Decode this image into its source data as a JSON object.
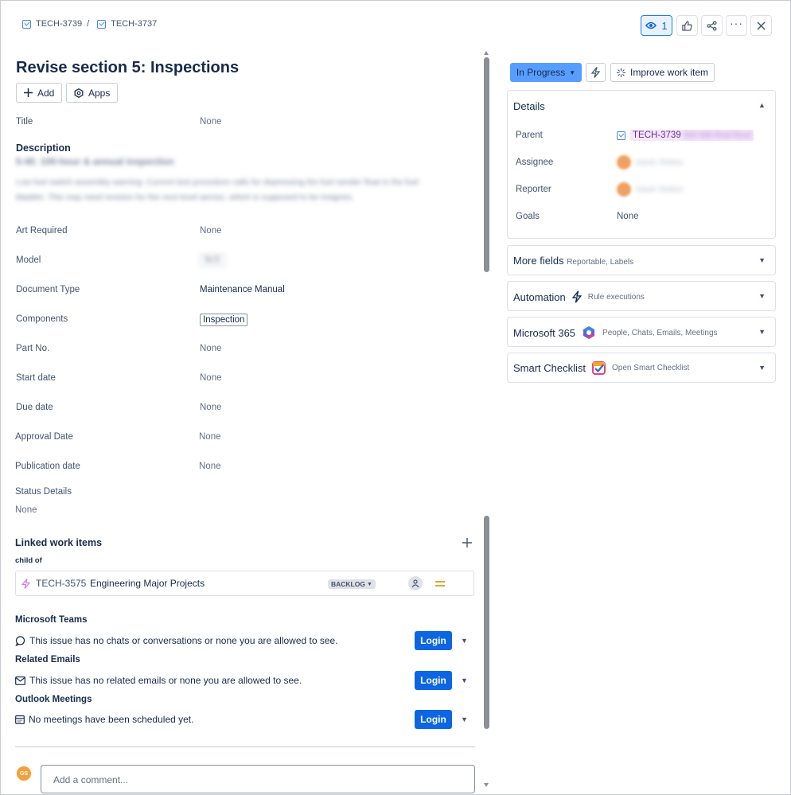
{
  "breadcrumb": {
    "parent_key": "TECH-3739",
    "separator": "/",
    "current_key": "TECH-3737"
  },
  "toolbar": {
    "watch_count": "1"
  },
  "issue": {
    "title": "Revise section 5: Inspections",
    "add_label": "Add",
    "apps_label": "Apps"
  },
  "fields": {
    "title_label": "Title",
    "title_value": "None",
    "description_label": "Description",
    "description_heading": "5-40. 100-hour & annual inspection",
    "description_body_1": "Low fuel switch assembly warning: Current test procedure calls for depressing the fuel sender float in the fuel",
    "description_body_2": "bladder. This may need revision for the next level aerosc. which is supposed to be insignes.",
    "art_label": "Art Required",
    "art_value": "None",
    "model_label": "Model",
    "model_value": "9cS",
    "doctype_label": "Document Type",
    "doctype_value": "Maintenance Manual",
    "components_label": "Components",
    "components_value": "Inspection",
    "part_label": "Part No.",
    "part_value": "None",
    "start_label": "Start date",
    "start_value": "None",
    "due_label": "Due date",
    "due_value": "None",
    "approval_label": "Approval Date",
    "approval_value": "None",
    "publication_label": "Publication date",
    "publication_value": "None",
    "status_details_label": "Status Details",
    "status_details_value": "None"
  },
  "linked": {
    "heading": "Linked work items",
    "relation": "child of",
    "item_key": "TECH-3575",
    "item_title": "Engineering Major Projects",
    "item_status": "BACKLOG"
  },
  "integrations": {
    "teams_heading": "Microsoft Teams",
    "teams_msg": "This issue has no chats or conversations or none you are allowed to see.",
    "emails_heading": "Related Emails",
    "emails_msg": "This issue has no related emails or none you are allowed to see.",
    "meetings_heading": "Outlook Meetings",
    "meetings_msg": "No meetings have been scheduled yet.",
    "login_label": "Login"
  },
  "comment": {
    "avatar_initials": "GS",
    "placeholder": "Add a comment..."
  },
  "sidebar": {
    "status": "In Progress",
    "improve_label": "Improve work item",
    "details_heading": "Details",
    "parent_label": "Parent",
    "parent_key": "TECH-3739",
    "parent_title": "500-589 Rvid Revit",
    "assignee_label": "Assignee",
    "assignee_name": "Gavin Stokes",
    "reporter_label": "Reporter",
    "reporter_name": "Gavin Stokes",
    "goals_label": "Goals",
    "goals_value": "None",
    "more_fields_heading": "More fields",
    "more_fields_sub": "Reportable, Labels",
    "automation_heading": "Automation",
    "automation_sub": "Rule executions",
    "m365_heading": "Microsoft 365",
    "m365_sub": "People, Chats, Emails, Meetings",
    "checklist_heading": "Smart Checklist",
    "checklist_sub": "Open Smart Checklist"
  },
  "colors": {
    "accent": "#0c66e4",
    "status_bg": "#579dff",
    "parent_tag_bg": "#f3e6fb"
  },
  "icons": [
    "checkbox-icon",
    "eye-icon",
    "thumbs-up-icon",
    "share-icon",
    "more-icon",
    "close-icon",
    "plus-icon",
    "apps-icon",
    "lightning-icon",
    "sparkle-icon",
    "chevron-down-icon",
    "chat-icon",
    "mail-icon",
    "calendar-icon",
    "user-icon",
    "priority-medium-icon",
    "m365-icon",
    "checklist-icon"
  ]
}
